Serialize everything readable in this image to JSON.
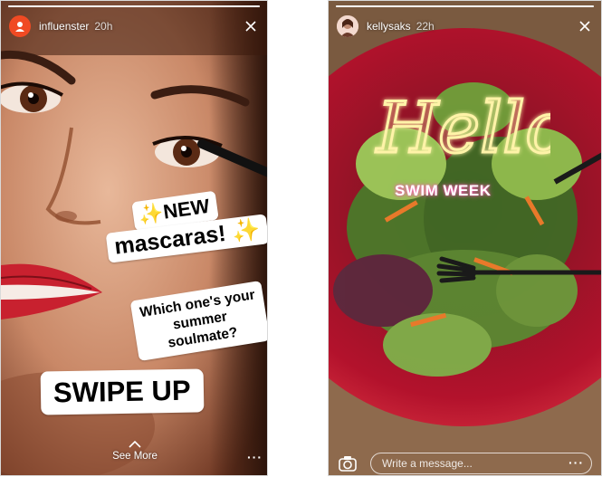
{
  "left_story": {
    "username": "influenster",
    "time": "20h",
    "progress": 1.0,
    "stickers": {
      "new_text": "NEW",
      "mascaras_text": "mascaras!",
      "question_text": "Which one's your summer soulmate?",
      "swipe_text": "SWIPE UP"
    },
    "see_more": "See More",
    "more_icon": "ellipsis-icon"
  },
  "right_story": {
    "username": "kellysaks",
    "time": "22h",
    "progress": 1.0,
    "hello_text": "Hello",
    "swim_week_text": "SWIM WEEK",
    "message_placeholder": "Write a message...",
    "camera_icon": "camera-icon",
    "more_icon": "ellipsis-icon"
  },
  "colors": {
    "accent_orange": "#f04a23",
    "neon_yellow": "#fff3a8",
    "neon_pink": "#ff58b8",
    "bowl_red": "#b3122c"
  }
}
